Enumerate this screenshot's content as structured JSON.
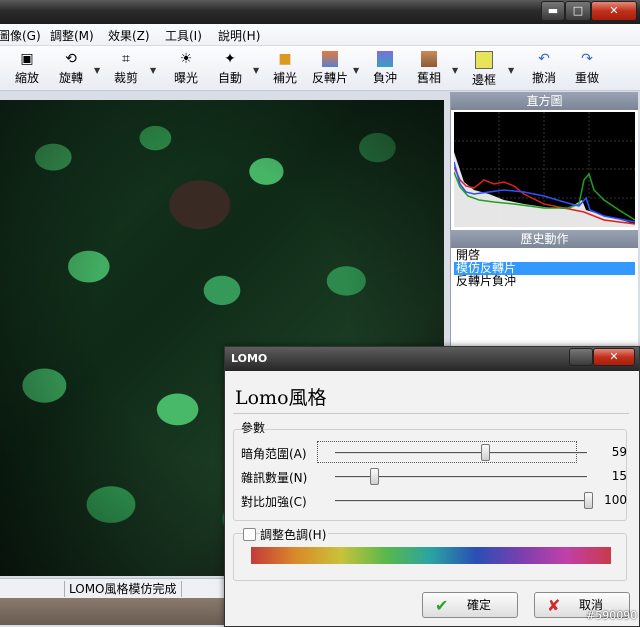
{
  "window": {
    "minimize_glyph": "▬",
    "maximize_glyph": "□",
    "close_glyph": "✕"
  },
  "menu": {
    "items": [
      "圖像(G)",
      "調整(M)",
      "效果(Z)",
      "工具(I)",
      "說明(H)"
    ]
  },
  "toolbar": {
    "tools": [
      {
        "label": "縮放",
        "icon": "zoom-icon"
      },
      {
        "label": "旋轉",
        "icon": "rotate-icon"
      },
      {
        "label": "裁剪",
        "icon": "crop-icon"
      },
      {
        "label": "曝光",
        "icon": "exposure-icon"
      },
      {
        "label": "自動",
        "icon": "auto-icon"
      },
      {
        "label": "補光",
        "icon": "fill-light-icon"
      },
      {
        "label": "反轉片",
        "icon": "reversal-icon"
      },
      {
        "label": "負沖",
        "icon": "cross-process-icon"
      },
      {
        "label": "舊相",
        "icon": "old-photo-icon"
      },
      {
        "label": "邊框",
        "icon": "border-icon"
      },
      {
        "label": "撤消",
        "icon": "undo-icon"
      },
      {
        "label": "重做",
        "icon": "redo-icon"
      }
    ]
  },
  "status": {
    "text": "LOMO風格模仿完成"
  },
  "panels": {
    "histogram_title": "直方圖",
    "history_title": "歷史動作",
    "history_items": [
      "開啓",
      "模仿反轉片",
      "反轉片負沖"
    ],
    "history_selected_index": 1
  },
  "dialog": {
    "title": "LOMO",
    "heading": "Lomo風格",
    "params_label": "參數",
    "params": [
      {
        "label": "暗角范圍(A)",
        "value": "59",
        "position": 0.59
      },
      {
        "label": "雜訊數量(N)",
        "value": "15",
        "position": 0.15
      },
      {
        "label": "對比加強(C)",
        "value": "100",
        "position": 1.0
      }
    ],
    "hue_checkbox_label": "調整色調(H)",
    "hue_checked": false,
    "ok_label": "確定",
    "cancel_label": "取消",
    "close_glyph": "✕"
  },
  "watermark": "#590090"
}
